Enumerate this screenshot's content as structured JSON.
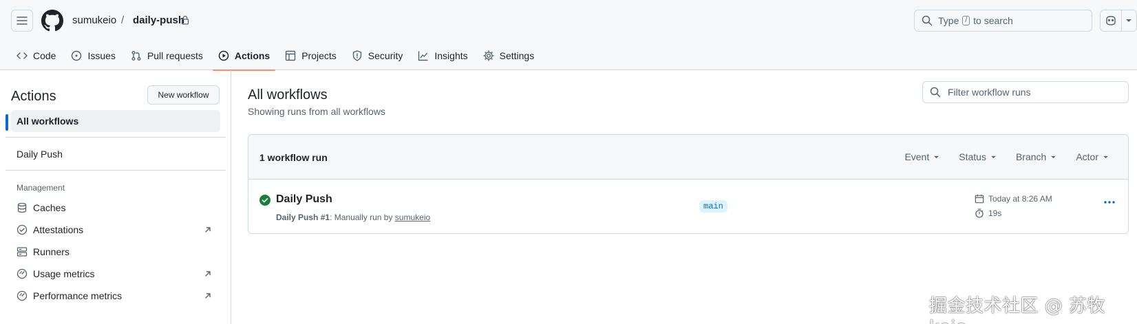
{
  "header": {
    "owner": "sumukeio",
    "separator": "/",
    "repo": "daily-push",
    "search": {
      "prefix": "Type",
      "key": "/",
      "suffix": "to search"
    }
  },
  "tabs": [
    {
      "label": "Code",
      "icon": "code-icon"
    },
    {
      "label": "Issues",
      "icon": "issue-opened-icon"
    },
    {
      "label": "Pull requests",
      "icon": "git-pull-request-icon"
    },
    {
      "label": "Actions",
      "icon": "play-icon",
      "selected": true
    },
    {
      "label": "Projects",
      "icon": "table-icon"
    },
    {
      "label": "Security",
      "icon": "shield-icon"
    },
    {
      "label": "Insights",
      "icon": "graph-icon"
    },
    {
      "label": "Settings",
      "icon": "gear-icon"
    }
  ],
  "sidebar": {
    "title": "Actions",
    "new_workflow": "New workflow",
    "all_workflows": "All workflows",
    "workflows": [
      "Daily Push"
    ],
    "management_label": "Management",
    "management": [
      {
        "label": "Caches",
        "icon": "database-icon",
        "external": false
      },
      {
        "label": "Attestations",
        "icon": "verified-icon",
        "external": true
      },
      {
        "label": "Runners",
        "icon": "server-icon",
        "external": false
      },
      {
        "label": "Usage metrics",
        "icon": "meter-icon",
        "external": true
      },
      {
        "label": "Performance metrics",
        "icon": "meter-icon",
        "external": true
      }
    ]
  },
  "main": {
    "title": "All workflows",
    "subtitle": "Showing runs from all workflows",
    "filter_placeholder": "Filter workflow runs",
    "run_count": "1 workflow run",
    "filters": [
      "Event",
      "Status",
      "Branch",
      "Actor"
    ],
    "runs": [
      {
        "title": "Daily Push",
        "workflow": "Daily Push",
        "number": "#1",
        "trigger": ": Manually run by",
        "actor": "sumukeio",
        "branch": "main",
        "time": "Today at 8:26 AM",
        "duration": "19s",
        "status": "success"
      }
    ]
  },
  "watermark": "掘金技术社区 @ 苏牧keio",
  "colors": {
    "accent": "#0969da",
    "success": "#1a7f37",
    "tab_underline": "#fd8c73"
  }
}
